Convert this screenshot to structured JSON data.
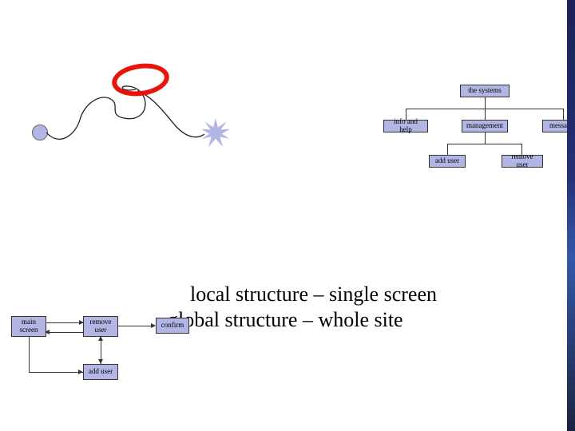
{
  "tree": {
    "root": "the systems",
    "level1": {
      "info": "info and help",
      "mgmt": "management",
      "msgs": "messages"
    },
    "level2": {
      "add": "add user",
      "remove": "remove user"
    }
  },
  "flow": {
    "main": "main screen",
    "remove": "remove user",
    "confirm": "confirm",
    "add": "add user"
  },
  "headline": {
    "line1": "local structure – single screen",
    "line2": "global structure – whole site"
  }
}
